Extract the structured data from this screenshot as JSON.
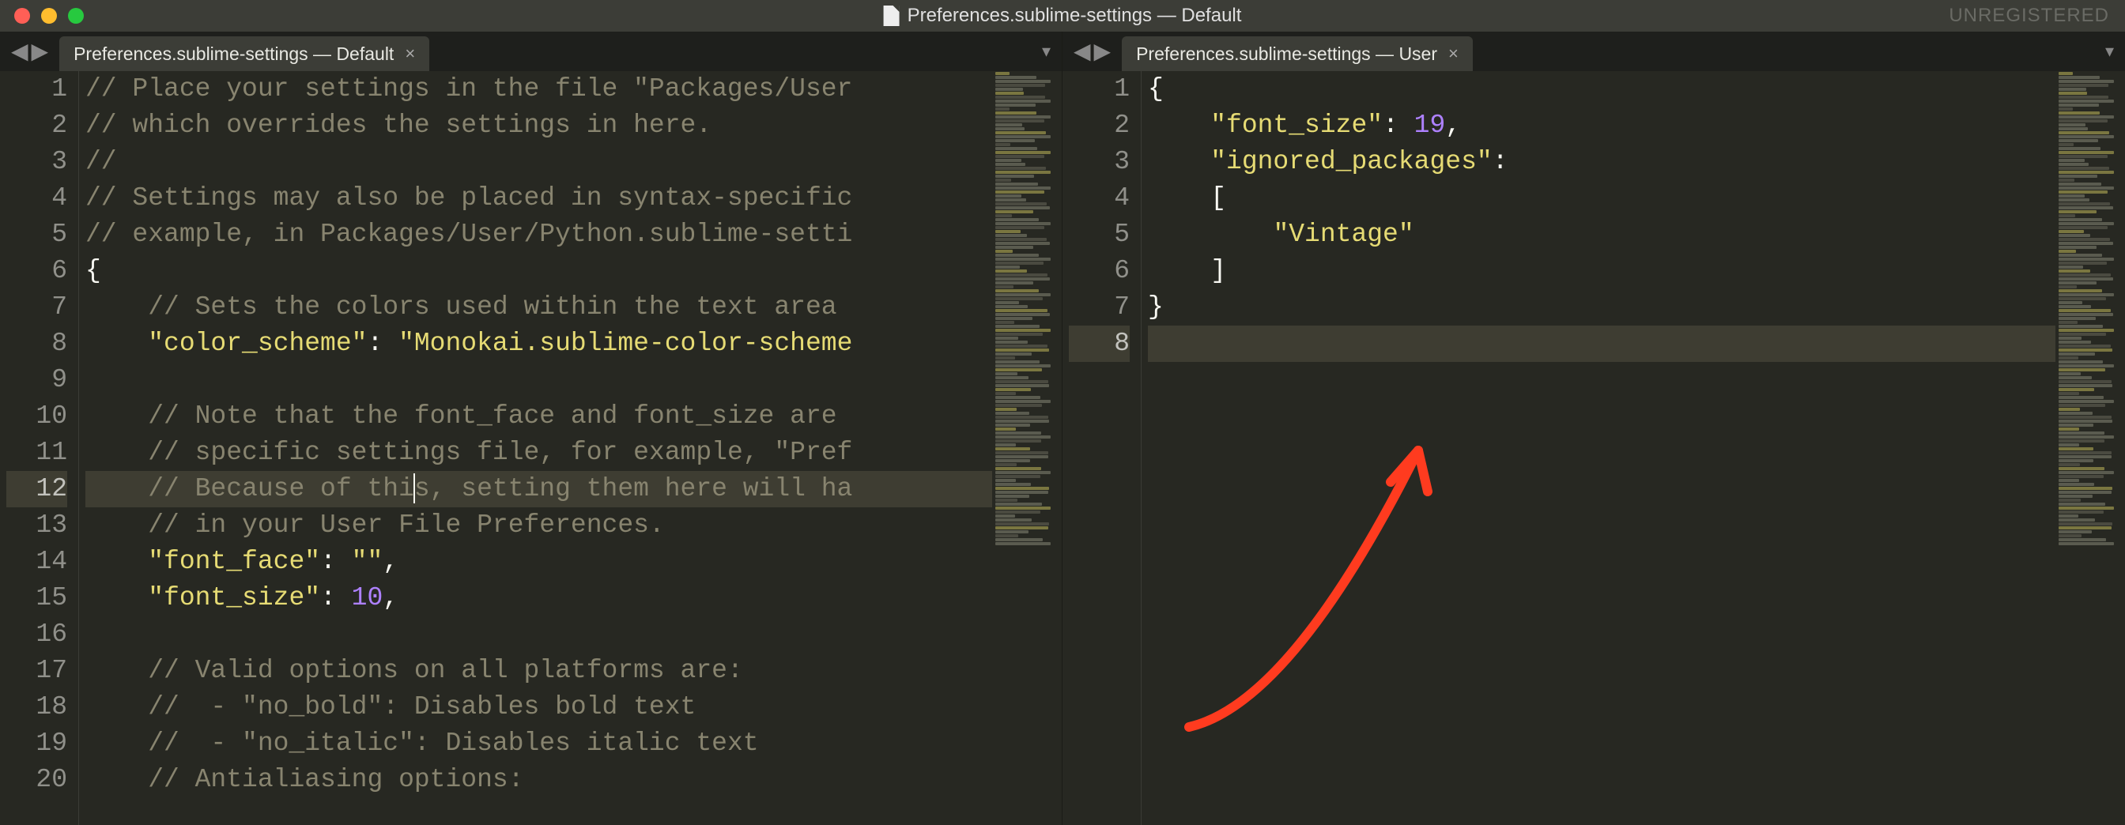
{
  "titlebar": {
    "title": "Preferences.sublime-settings — Default",
    "unregistered": "UNREGISTERED"
  },
  "left_pane": {
    "tab_title": "Preferences.sublime-settings — Default",
    "cursor_line": 12,
    "lines": [
      {
        "n": 1,
        "tokens": [
          {
            "c": "comment",
            "t": "// Place your settings in the file \"Packages/User"
          }
        ]
      },
      {
        "n": 2,
        "tokens": [
          {
            "c": "comment",
            "t": "// which overrides the settings in here."
          }
        ]
      },
      {
        "n": 3,
        "tokens": [
          {
            "c": "comment",
            "t": "//"
          }
        ]
      },
      {
        "n": 4,
        "tokens": [
          {
            "c": "comment",
            "t": "// Settings may also be placed in syntax-specific"
          }
        ]
      },
      {
        "n": 5,
        "tokens": [
          {
            "c": "comment",
            "t": "// example, in Packages/User/Python.sublime-setti"
          }
        ]
      },
      {
        "n": 6,
        "tokens": [
          {
            "c": "punct",
            "t": "{"
          }
        ]
      },
      {
        "n": 7,
        "indent": 1,
        "tokens": [
          {
            "c": "comment",
            "t": "// Sets the colors used within the text area"
          }
        ]
      },
      {
        "n": 8,
        "indent": 1,
        "tokens": [
          {
            "c": "key",
            "t": "\"color_scheme\""
          },
          {
            "c": "punct",
            "t": ": "
          },
          {
            "c": "string",
            "t": "\"Monokai.sublime-color-scheme"
          }
        ]
      },
      {
        "n": 9,
        "tokens": []
      },
      {
        "n": 10,
        "indent": 1,
        "tokens": [
          {
            "c": "comment",
            "t": "// Note that the font_face and font_size are "
          }
        ]
      },
      {
        "n": 11,
        "indent": 1,
        "tokens": [
          {
            "c": "comment",
            "t": "// specific settings file, for example, \"Pref"
          }
        ]
      },
      {
        "n": 12,
        "indent": 1,
        "tokens": [
          {
            "c": "comment",
            "t": "// Because of thi"
          },
          {
            "c": "cursor",
            "t": ""
          },
          {
            "c": "comment",
            "t": "s, setting them here will ha"
          }
        ]
      },
      {
        "n": 13,
        "indent": 1,
        "tokens": [
          {
            "c": "comment",
            "t": "// in your User File Preferences."
          }
        ]
      },
      {
        "n": 14,
        "indent": 1,
        "tokens": [
          {
            "c": "key",
            "t": "\"font_face\""
          },
          {
            "c": "punct",
            "t": ": "
          },
          {
            "c": "string",
            "t": "\"\""
          },
          {
            "c": "punct",
            "t": ","
          }
        ]
      },
      {
        "n": 15,
        "indent": 1,
        "tokens": [
          {
            "c": "key",
            "t": "\"font_size\""
          },
          {
            "c": "punct",
            "t": ": "
          },
          {
            "c": "number",
            "t": "10"
          },
          {
            "c": "punct",
            "t": ","
          }
        ]
      },
      {
        "n": 16,
        "tokens": []
      },
      {
        "n": 17,
        "indent": 1,
        "tokens": [
          {
            "c": "comment",
            "t": "// Valid options on all platforms are:"
          }
        ]
      },
      {
        "n": 18,
        "indent": 1,
        "tokens": [
          {
            "c": "comment",
            "t": "//  - \"no_bold\": Disables bold text"
          }
        ]
      },
      {
        "n": 19,
        "indent": 1,
        "tokens": [
          {
            "c": "comment",
            "t": "//  - \"no_italic\": Disables italic text"
          }
        ]
      },
      {
        "n": 20,
        "indent": 1,
        "tokens": [
          {
            "c": "comment",
            "t": "// Antialiasing options:"
          }
        ]
      }
    ]
  },
  "right_pane": {
    "tab_title": "Preferences.sublime-settings — User",
    "active_line": 8,
    "lines": [
      {
        "n": 1,
        "tokens": [
          {
            "c": "punct",
            "t": "{"
          }
        ]
      },
      {
        "n": 2,
        "indent": 1,
        "tokens": [
          {
            "c": "key",
            "t": "\"font_size\""
          },
          {
            "c": "punct",
            "t": ": "
          },
          {
            "c": "number",
            "t": "19"
          },
          {
            "c": "punct",
            "t": ","
          }
        ]
      },
      {
        "n": 3,
        "indent": 1,
        "tokens": [
          {
            "c": "key",
            "t": "\"ignored_packages\""
          },
          {
            "c": "punct",
            "t": ":"
          }
        ]
      },
      {
        "n": 4,
        "indent": 1,
        "tokens": [
          {
            "c": "punct",
            "t": "["
          }
        ]
      },
      {
        "n": 5,
        "indent": 2,
        "tokens": [
          {
            "c": "string",
            "t": "\"Vintage\""
          }
        ]
      },
      {
        "n": 6,
        "indent": 1,
        "tokens": [
          {
            "c": "punct",
            "t": "]"
          }
        ]
      },
      {
        "n": 7,
        "tokens": [
          {
            "c": "punct",
            "t": "}"
          }
        ]
      },
      {
        "n": 8,
        "tokens": []
      }
    ]
  },
  "icons": {
    "nav_back": "◀",
    "nav_fwd": "▶",
    "close": "×",
    "dropdown": "▾"
  }
}
